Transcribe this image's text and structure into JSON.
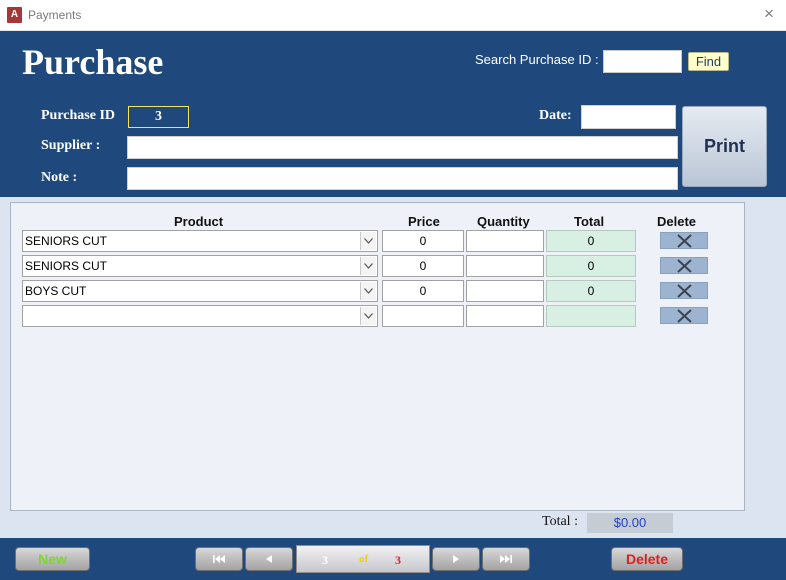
{
  "window": {
    "title": "Payments",
    "close_glyph": "×",
    "app_icon_letter": "A"
  },
  "header": {
    "title": "Purchase",
    "search_label": "Search Purchase ID :",
    "search_value": "",
    "find_label": "Find",
    "purchase_id_label": "Purchase ID",
    "purchase_id_value": "3",
    "date_label": "Date:",
    "date_value": "",
    "supplier_label": "Supplier :",
    "supplier_value": "",
    "note_label": "Note :",
    "note_value": "",
    "print_label": "Print"
  },
  "details": {
    "columns": [
      "Product",
      "Price",
      "Quantity",
      "Total",
      "Delete"
    ],
    "rows": [
      {
        "product": "SENIORS CUT",
        "price": "0",
        "quantity": "",
        "total": "0"
      },
      {
        "product": "SENIORS CUT",
        "price": "0",
        "quantity": "",
        "total": "0"
      },
      {
        "product": "BOYS CUT",
        "price": "0",
        "quantity": "",
        "total": "0"
      },
      {
        "product": "",
        "price": "",
        "quantity": "",
        "total": ""
      }
    ],
    "total_label": "Total :",
    "total_value": "$0.00"
  },
  "footer": {
    "new_label": "New",
    "delete_label": "Delete",
    "record_current": "3",
    "record_of": "of",
    "record_total": "3"
  },
  "colors": {
    "header_bg": "#1f497d",
    "body_bg": "#dbe4f0",
    "total_cell_bg": "#d8efe4",
    "new_text": "#7ed631",
    "delete_text": "#e21d1d"
  }
}
